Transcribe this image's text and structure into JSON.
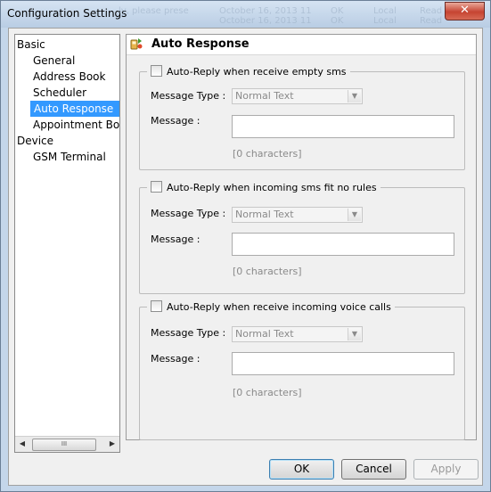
{
  "window": {
    "title": "Configuration Settings",
    "close_label": "✕",
    "background_ghost_text": [
      "ly, please prese",
      "October 16, 2013 11",
      "OK",
      "Local",
      "Read",
      "October 16, 2013 11",
      "OK",
      "Local",
      "Read"
    ]
  },
  "tree": {
    "items": [
      {
        "label": "Basic",
        "level": 0
      },
      {
        "label": "General",
        "level": 1
      },
      {
        "label": "Address Book",
        "level": 1
      },
      {
        "label": "Scheduler",
        "level": 1
      },
      {
        "label": "Auto Response",
        "level": 1,
        "selected": true
      },
      {
        "label": "Appointment Boo",
        "level": 1
      },
      {
        "label": "Device",
        "level": 0
      },
      {
        "label": "GSM Terminal",
        "level": 1
      }
    ],
    "scroll": {
      "left_arrow": "◀",
      "thumb_grip": "III",
      "right_arrow": "▶"
    }
  },
  "panel": {
    "title": "Auto Response",
    "icon": "auto-response-icon",
    "groups": [
      {
        "checkbox_label": "Auto-Reply when receive empty sms",
        "message_type_label": "Message Type :",
        "message_type_value": "Normal Text",
        "message_label": "Message :",
        "message_value": "",
        "char_count": "[0 characters]"
      },
      {
        "checkbox_label": "Auto-Reply when incoming sms fit no rules",
        "message_type_label": "Message Type :",
        "message_type_value": "Normal Text",
        "message_label": "Message :",
        "message_value": "",
        "char_count": "[0 characters]"
      },
      {
        "checkbox_label": "Auto-Reply when receive incoming voice calls",
        "message_type_label": "Message Type :",
        "message_type_value": "Normal Text",
        "message_label": "Message :",
        "message_value": "",
        "char_count": "[0 characters]"
      }
    ]
  },
  "buttons": {
    "ok": "OK",
    "cancel": "Cancel",
    "apply": "Apply"
  },
  "colors": {
    "selection": "#3399ff",
    "close_button": "#c64432",
    "frame": "#c4d6ea"
  }
}
